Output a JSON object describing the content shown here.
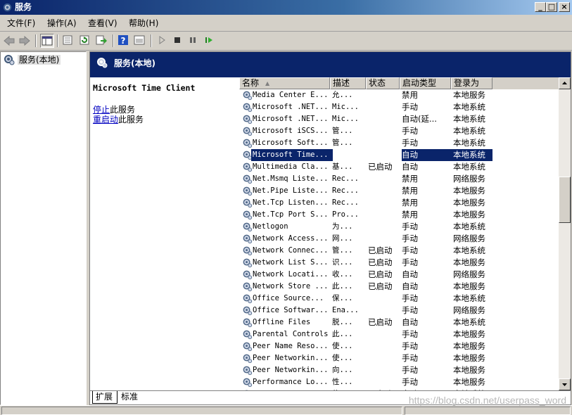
{
  "window": {
    "title": "服务",
    "minimize": "_",
    "restore": "□",
    "close": "×"
  },
  "menu": [
    {
      "label": "文件(F)"
    },
    {
      "label": "操作(A)"
    },
    {
      "label": "查看(V)"
    },
    {
      "label": "帮助(H)"
    }
  ],
  "toolbar": {
    "icons": [
      "back-icon",
      "forward-icon",
      "show-hide-tree-icon",
      "properties-icon",
      "refresh-icon",
      "export-icon",
      "help-icon",
      "console-icon",
      "start-icon",
      "stop-icon",
      "pause-icon",
      "restart-icon"
    ]
  },
  "tree": {
    "root": "服务(本地)"
  },
  "header": {
    "title": "服务(本地)"
  },
  "description": {
    "service_name": "Microsoft Time Client",
    "stop_link": "停止",
    "stop_suffix": "此服务",
    "restart_link": "重启动",
    "restart_suffix": "此服务"
  },
  "columns": [
    "名称",
    "描述",
    "状态",
    "启动类型",
    "登录为"
  ],
  "sort_indicator": "▲",
  "services": [
    {
      "name": "Media Center E...",
      "desc": "允...",
      "status": "",
      "startup": "禁用",
      "logon": "本地服务"
    },
    {
      "name": "Microsoft .NET...",
      "desc": "Mic...",
      "status": "",
      "startup": "手动",
      "logon": "本地系统"
    },
    {
      "name": "Microsoft .NET...",
      "desc": "Mic...",
      "status": "",
      "startup": "自动(延...",
      "logon": "本地系统"
    },
    {
      "name": "Microsoft iSCS...",
      "desc": "管...",
      "status": "",
      "startup": "手动",
      "logon": "本地系统"
    },
    {
      "name": "Microsoft Soft...",
      "desc": "管...",
      "status": "",
      "startup": "手动",
      "logon": "本地系统"
    },
    {
      "name": "Microsoft Time...",
      "desc": "",
      "status": "",
      "startup": "自动",
      "logon": "本地系统",
      "selected": true
    },
    {
      "name": "Multimedia Cla...",
      "desc": "基...",
      "status": "已启动",
      "startup": "自动",
      "logon": "本地系统"
    },
    {
      "name": "Net.Msmq Liste...",
      "desc": "Rec...",
      "status": "",
      "startup": "禁用",
      "logon": "网络服务"
    },
    {
      "name": "Net.Pipe Liste...",
      "desc": "Rec...",
      "status": "",
      "startup": "禁用",
      "logon": "本地服务"
    },
    {
      "name": "Net.Tcp Listen...",
      "desc": "Rec...",
      "status": "",
      "startup": "禁用",
      "logon": "本地服务"
    },
    {
      "name": "Net.Tcp Port S...",
      "desc": "Pro...",
      "status": "",
      "startup": "禁用",
      "logon": "本地服务"
    },
    {
      "name": "Netlogon",
      "desc": "为...",
      "status": "",
      "startup": "手动",
      "logon": "本地系统"
    },
    {
      "name": "Network Access...",
      "desc": "网...",
      "status": "",
      "startup": "手动",
      "logon": "网络服务"
    },
    {
      "name": "Network Connec...",
      "desc": "管...",
      "status": "已启动",
      "startup": "手动",
      "logon": "本地系统"
    },
    {
      "name": "Network List S...",
      "desc": "识...",
      "status": "已启动",
      "startup": "手动",
      "logon": "本地服务"
    },
    {
      "name": "Network Locati...",
      "desc": "收...",
      "status": "已启动",
      "startup": "自动",
      "logon": "网络服务"
    },
    {
      "name": "Network Store ...",
      "desc": "此...",
      "status": "已启动",
      "startup": "自动",
      "logon": "本地服务"
    },
    {
      "name": "Office  Source...",
      "desc": "保...",
      "status": "",
      "startup": "手动",
      "logon": "本地系统"
    },
    {
      "name": "Office Softwar...",
      "desc": "Ena...",
      "status": "",
      "startup": "手动",
      "logon": "网络服务"
    },
    {
      "name": "Offline Files",
      "desc": "脱...",
      "status": "已启动",
      "startup": "自动",
      "logon": "本地系统"
    },
    {
      "name": "Parental Controls",
      "desc": "此...",
      "status": "",
      "startup": "手动",
      "logon": "本地服务"
    },
    {
      "name": "Peer Name Reso...",
      "desc": "使...",
      "status": "",
      "startup": "手动",
      "logon": "本地服务"
    },
    {
      "name": "Peer Networkin...",
      "desc": "使...",
      "status": "",
      "startup": "手动",
      "logon": "本地服务"
    },
    {
      "name": "Peer Networkin...",
      "desc": "向...",
      "status": "",
      "startup": "手动",
      "logon": "本地服务"
    },
    {
      "name": "Performance Lo...",
      "desc": "性...",
      "status": "",
      "startup": "手动",
      "logon": "本地服务"
    },
    {
      "name": "Performance Co...",
      "desc": "使...",
      "status": "已启动",
      "startup": "自动",
      "logon": "本地系统"
    }
  ],
  "tabs": [
    {
      "label": "扩展"
    },
    {
      "label": "标准"
    }
  ],
  "watermark": "https://blog.csdn.net/userpass_word",
  "colors": {
    "title_bar": "#0a246a",
    "selection": "#0a246a",
    "link": "#0000c0"
  }
}
